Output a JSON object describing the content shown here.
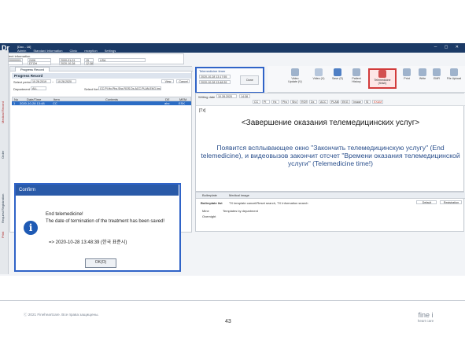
{
  "app": {
    "logo": "Dr",
    "title": "[Doc - 16]",
    "menu": [
      "Admin",
      "Standard information",
      "Clinic",
      "reception",
      "Settings"
    ]
  },
  "patient": {
    "label": "Patient information",
    "cells": [
      "2020000001",
      "2406",
      "2000-01-01",
      "15",
      "USA",
      "M",
      "DTOH",
      "2020-10-28",
      "12:38"
    ]
  },
  "leftnav": {
    "tabs": [
      "Medical Record",
      "Order",
      "Request Registration",
      "Print"
    ]
  },
  "progress": {
    "tab": "Progress Record",
    "record_label": "Progress Record",
    "filter_label": "Select period",
    "period_from": "10.28.2019",
    "period_to": "10.28.2020",
    "dept_label": "Department",
    "all_label": "ALL",
    "items_label": "Select Items",
    "items_value": "CC,PI,Hx,Phx,Shx,ROS,Dx,ACC,PLAN,EKG,Image,SI,EXAM",
    "view_btn": "View",
    "cancel_btn": "Cancel",
    "columns": [
      "No",
      "Date/Time",
      "Item",
      "Contents",
      "DE",
      "MEM"
    ],
    "row": [
      "1",
      "2020-10-28 13:48",
      "CC",
      "",
      "abc",
      "ESK"
    ]
  },
  "telemed": {
    "label": "Telemedicine timer",
    "start": "2020-10-28 13:17:55",
    "end": "2020-10-28 13:48:39",
    "done_btn": "Done"
  },
  "toolbar": {
    "buttons": [
      "Video Update (V)",
      "Video (V)",
      "Save (S)",
      "Patient History",
      "Telemedicine (finish)",
      "Print",
      "Write",
      "EMR",
      "File Upload"
    ]
  },
  "side_buttons": [
    "Save",
    "Edit",
    "Delete"
  ],
  "note": {
    "date_label": "Writing date",
    "date": "10.28.2020",
    "time": "14:38",
    "chips": [
      "CC",
      "PI",
      "Hx",
      "Phx",
      "Shx",
      "ROS",
      "Dx",
      "ACC",
      "PLAN",
      "EKG",
      "Image",
      "SI",
      "EXAM"
    ],
    "tab": "[Tx]"
  },
  "overlay": {
    "title": "<Завершение оказания телемедицинских услуг>",
    "text": "Появится всплывающее окно \"Закончить телемедицинскую услугу\" (End telemedicine), и видеовызов закончит отсчет \"Времени оказания телемедицинской услуги\" (Telemedicine time!)"
  },
  "bottom": {
    "tabs": [
      "Boilerplate",
      "Medical image"
    ],
    "list_label": "Boilerplate list",
    "list_text": "TX template cancel/Reset search, TX Information search",
    "btn1": "Default",
    "btn2": "Registration",
    "col1": "Mine",
    "col2": "Templates by department",
    "row1": "Overnight"
  },
  "dialog": {
    "title": "Confirm",
    "line1": "End telemedicine!",
    "line2": "The date of termination of the treatment has been saved!",
    "time_line": "=> 2020-10-28 13:48:39 (한국 표준시)",
    "ok": "OK(O)"
  },
  "footer": {
    "copyright": "ⓒ 2021 Fineheartcare. Все права защищены.",
    "page": "43",
    "brand_top": "fine i",
    "brand_bottom": "heart care"
  }
}
